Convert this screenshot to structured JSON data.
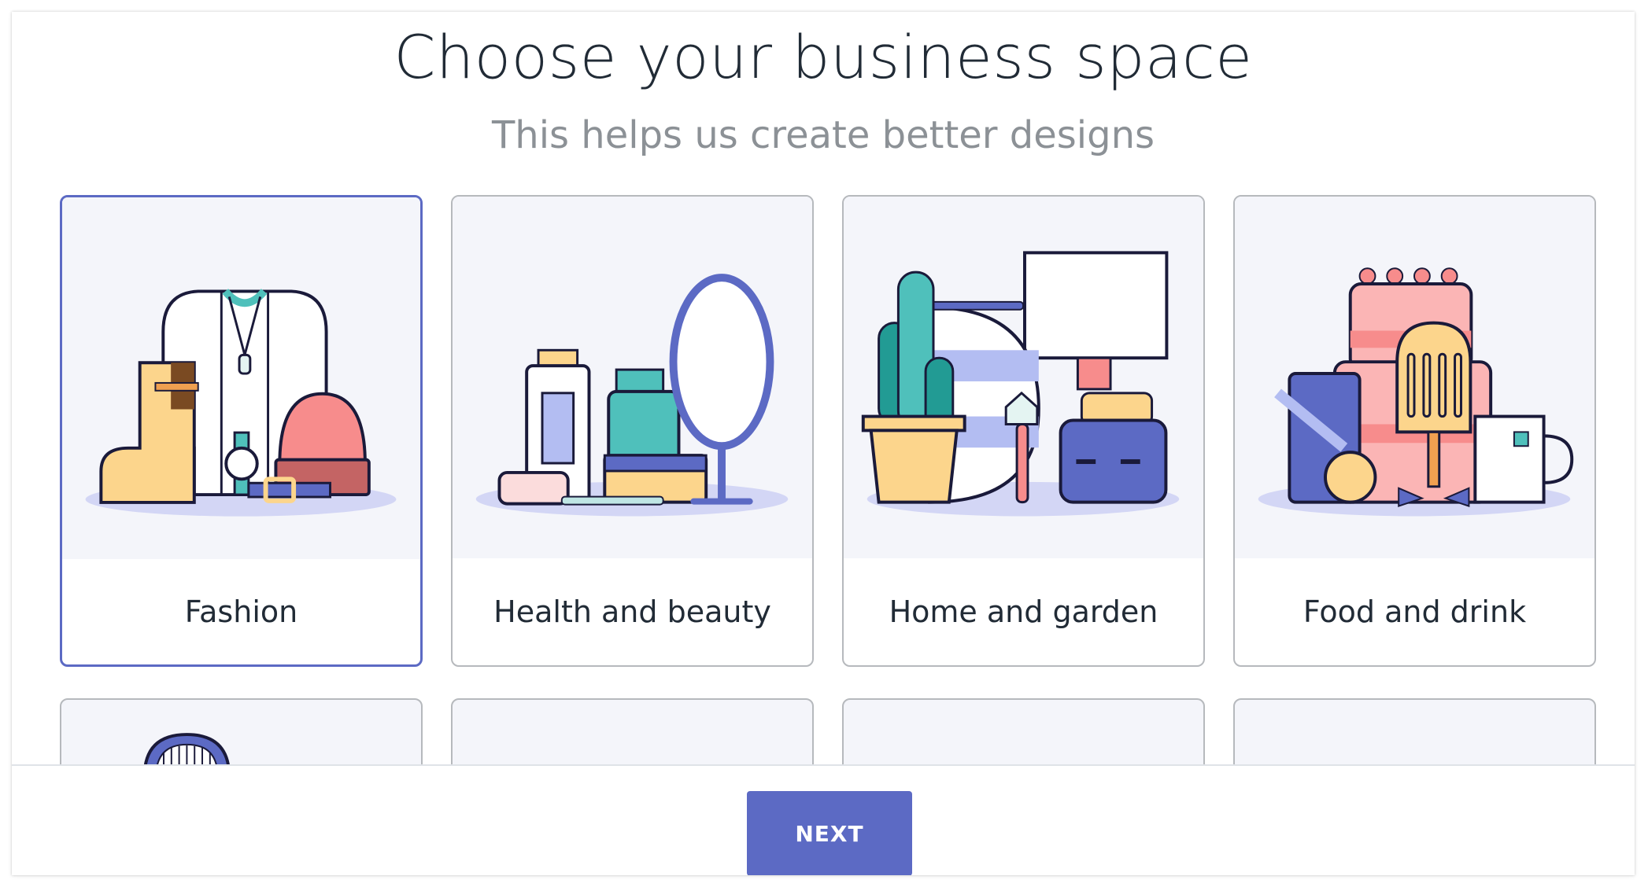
{
  "header": {
    "title": "Choose your business space",
    "subtitle": "This helps us create better designs"
  },
  "categories": [
    {
      "label": "Fashion",
      "selected": true,
      "icon": "fashion-illustration"
    },
    {
      "label": "Health and beauty",
      "selected": false,
      "icon": "health-beauty-illustration"
    },
    {
      "label": "Home and garden",
      "selected": false,
      "icon": "home-garden-illustration"
    },
    {
      "label": "Food and drink",
      "selected": false,
      "icon": "food-drink-illustration"
    }
  ],
  "footer": {
    "next_label": "NEXT"
  },
  "colors": {
    "accent": "#5c6ac4",
    "title": "#212b36",
    "subtitle": "#8c9196",
    "card_art_bg": "#f4f5fa"
  }
}
